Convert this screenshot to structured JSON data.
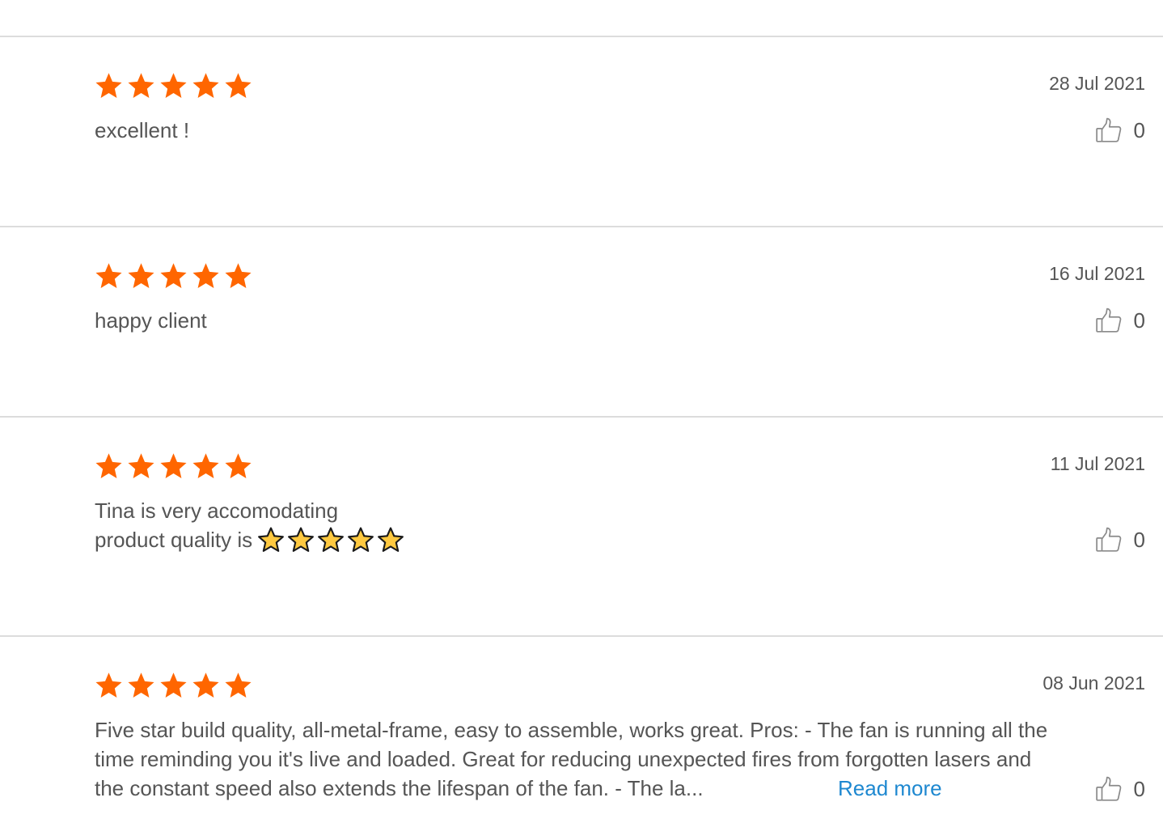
{
  "colors": {
    "star": "#ff6600",
    "text": "#555555",
    "link": "#1e88d0",
    "divider": "#dcdcdc",
    "emoji_star_fill": "#ffc940"
  },
  "reviews": [
    {
      "rating": 5,
      "date": "28 Jul 2021",
      "text_lines": [
        "excellent !"
      ],
      "likes": "0"
    },
    {
      "rating": 5,
      "date": "16 Jul 2021",
      "text_lines": [
        "happy client"
      ],
      "likes": "0"
    },
    {
      "rating": 5,
      "date": "11 Jul 2021",
      "text_lines": [
        "Tina is very accomodating",
        "product quality is"
      ],
      "emoji_stars": 5,
      "likes": "0"
    },
    {
      "rating": 5,
      "date": "08 Jun 2021",
      "text_lines": [
        "Five star build quality, all-metal-frame, easy to assemble, works great. Pros: - The fan is running all the",
        "time reminding you it's live and loaded. Great for reducing unexpected fires from forgotten lasers and",
        "the constant speed also extends the lifespan of the fan. - The la..."
      ],
      "read_more": "Read more",
      "likes": "0"
    }
  ]
}
